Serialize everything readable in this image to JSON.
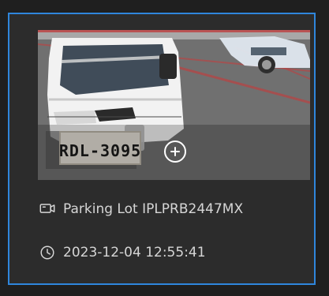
{
  "card": {
    "plate_text": "RDL-3095",
    "camera_label": "Parking Lot IPLPRB2447MX",
    "timestamp": "2023-12-04 12:55:41"
  },
  "icons": {
    "add": "add-circle-icon",
    "camera": "camera-icon",
    "clock": "clock-icon"
  },
  "colors": {
    "accent_border": "#2f86dc",
    "card_bg": "#2c2c2c",
    "text": "#d6d6d6"
  }
}
